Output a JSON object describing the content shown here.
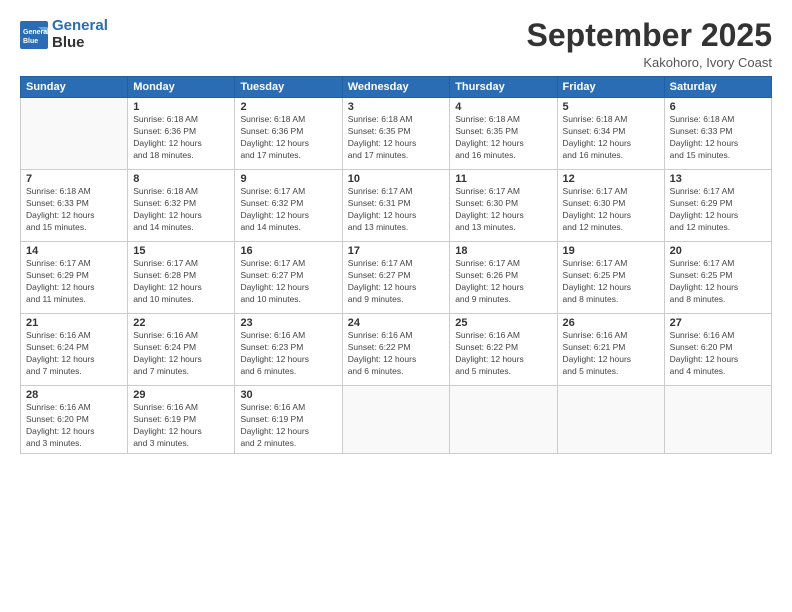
{
  "header": {
    "logo_line1": "General",
    "logo_line2": "Blue",
    "month": "September 2025",
    "location": "Kakohoro, Ivory Coast"
  },
  "weekdays": [
    "Sunday",
    "Monday",
    "Tuesday",
    "Wednesday",
    "Thursday",
    "Friday",
    "Saturday"
  ],
  "weeks": [
    [
      {
        "day": "",
        "info": ""
      },
      {
        "day": "1",
        "info": "Sunrise: 6:18 AM\nSunset: 6:36 PM\nDaylight: 12 hours\nand 18 minutes."
      },
      {
        "day": "2",
        "info": "Sunrise: 6:18 AM\nSunset: 6:36 PM\nDaylight: 12 hours\nand 17 minutes."
      },
      {
        "day": "3",
        "info": "Sunrise: 6:18 AM\nSunset: 6:35 PM\nDaylight: 12 hours\nand 17 minutes."
      },
      {
        "day": "4",
        "info": "Sunrise: 6:18 AM\nSunset: 6:35 PM\nDaylight: 12 hours\nand 16 minutes."
      },
      {
        "day": "5",
        "info": "Sunrise: 6:18 AM\nSunset: 6:34 PM\nDaylight: 12 hours\nand 16 minutes."
      },
      {
        "day": "6",
        "info": "Sunrise: 6:18 AM\nSunset: 6:33 PM\nDaylight: 12 hours\nand 15 minutes."
      }
    ],
    [
      {
        "day": "7",
        "info": "Sunrise: 6:18 AM\nSunset: 6:33 PM\nDaylight: 12 hours\nand 15 minutes."
      },
      {
        "day": "8",
        "info": "Sunrise: 6:18 AM\nSunset: 6:32 PM\nDaylight: 12 hours\nand 14 minutes."
      },
      {
        "day": "9",
        "info": "Sunrise: 6:17 AM\nSunset: 6:32 PM\nDaylight: 12 hours\nand 14 minutes."
      },
      {
        "day": "10",
        "info": "Sunrise: 6:17 AM\nSunset: 6:31 PM\nDaylight: 12 hours\nand 13 minutes."
      },
      {
        "day": "11",
        "info": "Sunrise: 6:17 AM\nSunset: 6:30 PM\nDaylight: 12 hours\nand 13 minutes."
      },
      {
        "day": "12",
        "info": "Sunrise: 6:17 AM\nSunset: 6:30 PM\nDaylight: 12 hours\nand 12 minutes."
      },
      {
        "day": "13",
        "info": "Sunrise: 6:17 AM\nSunset: 6:29 PM\nDaylight: 12 hours\nand 12 minutes."
      }
    ],
    [
      {
        "day": "14",
        "info": "Sunrise: 6:17 AM\nSunset: 6:29 PM\nDaylight: 12 hours\nand 11 minutes."
      },
      {
        "day": "15",
        "info": "Sunrise: 6:17 AM\nSunset: 6:28 PM\nDaylight: 12 hours\nand 10 minutes."
      },
      {
        "day": "16",
        "info": "Sunrise: 6:17 AM\nSunset: 6:27 PM\nDaylight: 12 hours\nand 10 minutes."
      },
      {
        "day": "17",
        "info": "Sunrise: 6:17 AM\nSunset: 6:27 PM\nDaylight: 12 hours\nand 9 minutes."
      },
      {
        "day": "18",
        "info": "Sunrise: 6:17 AM\nSunset: 6:26 PM\nDaylight: 12 hours\nand 9 minutes."
      },
      {
        "day": "19",
        "info": "Sunrise: 6:17 AM\nSunset: 6:25 PM\nDaylight: 12 hours\nand 8 minutes."
      },
      {
        "day": "20",
        "info": "Sunrise: 6:17 AM\nSunset: 6:25 PM\nDaylight: 12 hours\nand 8 minutes."
      }
    ],
    [
      {
        "day": "21",
        "info": "Sunrise: 6:16 AM\nSunset: 6:24 PM\nDaylight: 12 hours\nand 7 minutes."
      },
      {
        "day": "22",
        "info": "Sunrise: 6:16 AM\nSunset: 6:24 PM\nDaylight: 12 hours\nand 7 minutes."
      },
      {
        "day": "23",
        "info": "Sunrise: 6:16 AM\nSunset: 6:23 PM\nDaylight: 12 hours\nand 6 minutes."
      },
      {
        "day": "24",
        "info": "Sunrise: 6:16 AM\nSunset: 6:22 PM\nDaylight: 12 hours\nand 6 minutes."
      },
      {
        "day": "25",
        "info": "Sunrise: 6:16 AM\nSunset: 6:22 PM\nDaylight: 12 hours\nand 5 minutes."
      },
      {
        "day": "26",
        "info": "Sunrise: 6:16 AM\nSunset: 6:21 PM\nDaylight: 12 hours\nand 5 minutes."
      },
      {
        "day": "27",
        "info": "Sunrise: 6:16 AM\nSunset: 6:20 PM\nDaylight: 12 hours\nand 4 minutes."
      }
    ],
    [
      {
        "day": "28",
        "info": "Sunrise: 6:16 AM\nSunset: 6:20 PM\nDaylight: 12 hours\nand 3 minutes."
      },
      {
        "day": "29",
        "info": "Sunrise: 6:16 AM\nSunset: 6:19 PM\nDaylight: 12 hours\nand 3 minutes."
      },
      {
        "day": "30",
        "info": "Sunrise: 6:16 AM\nSunset: 6:19 PM\nDaylight: 12 hours\nand 2 minutes."
      },
      {
        "day": "",
        "info": ""
      },
      {
        "day": "",
        "info": ""
      },
      {
        "day": "",
        "info": ""
      },
      {
        "day": "",
        "info": ""
      }
    ]
  ]
}
